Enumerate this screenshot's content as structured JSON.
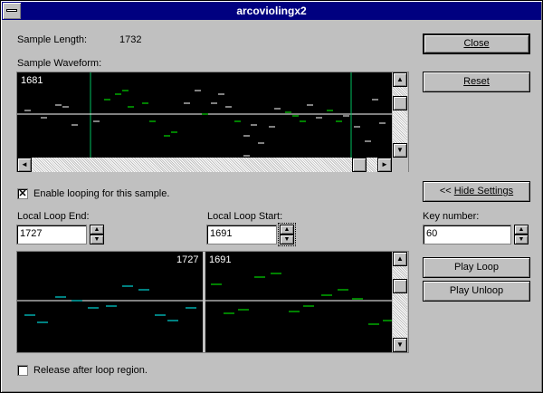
{
  "window": {
    "title": "arcoviolingx2"
  },
  "sample": {
    "length_label": "Sample Length:",
    "length_value": "1732",
    "waveform_label": "Sample Waveform:",
    "waveform_position": "1681"
  },
  "looping": {
    "enable_label": "Enable looping for this sample.",
    "enable_checked": "✕",
    "loop_end_label": "Local Loop End:",
    "loop_end_value": "1727",
    "loop_start_label": "Local Loop Start:",
    "loop_start_value": "1691",
    "key_number_label": "Key number:",
    "key_number_value": "60",
    "release_label": "Release after loop region."
  },
  "buttons": {
    "close": "Close",
    "reset": "Reset",
    "hide_settings_prefix": "<< ",
    "hide_settings": "Hide Settings",
    "play_loop": "Play Loop",
    "play_unloop": "Play Unloop"
  },
  "loop_view": {
    "end_readout": "1727",
    "start_readout": "1691"
  },
  "colors": {
    "grid": "#ffffff",
    "marker": "#00c060",
    "green": "#00ff00",
    "cyan": "#00ffff",
    "white": "#ffffff"
  },
  "icons": {
    "up": "▲",
    "down": "▼",
    "left": "◄",
    "right": "►"
  }
}
